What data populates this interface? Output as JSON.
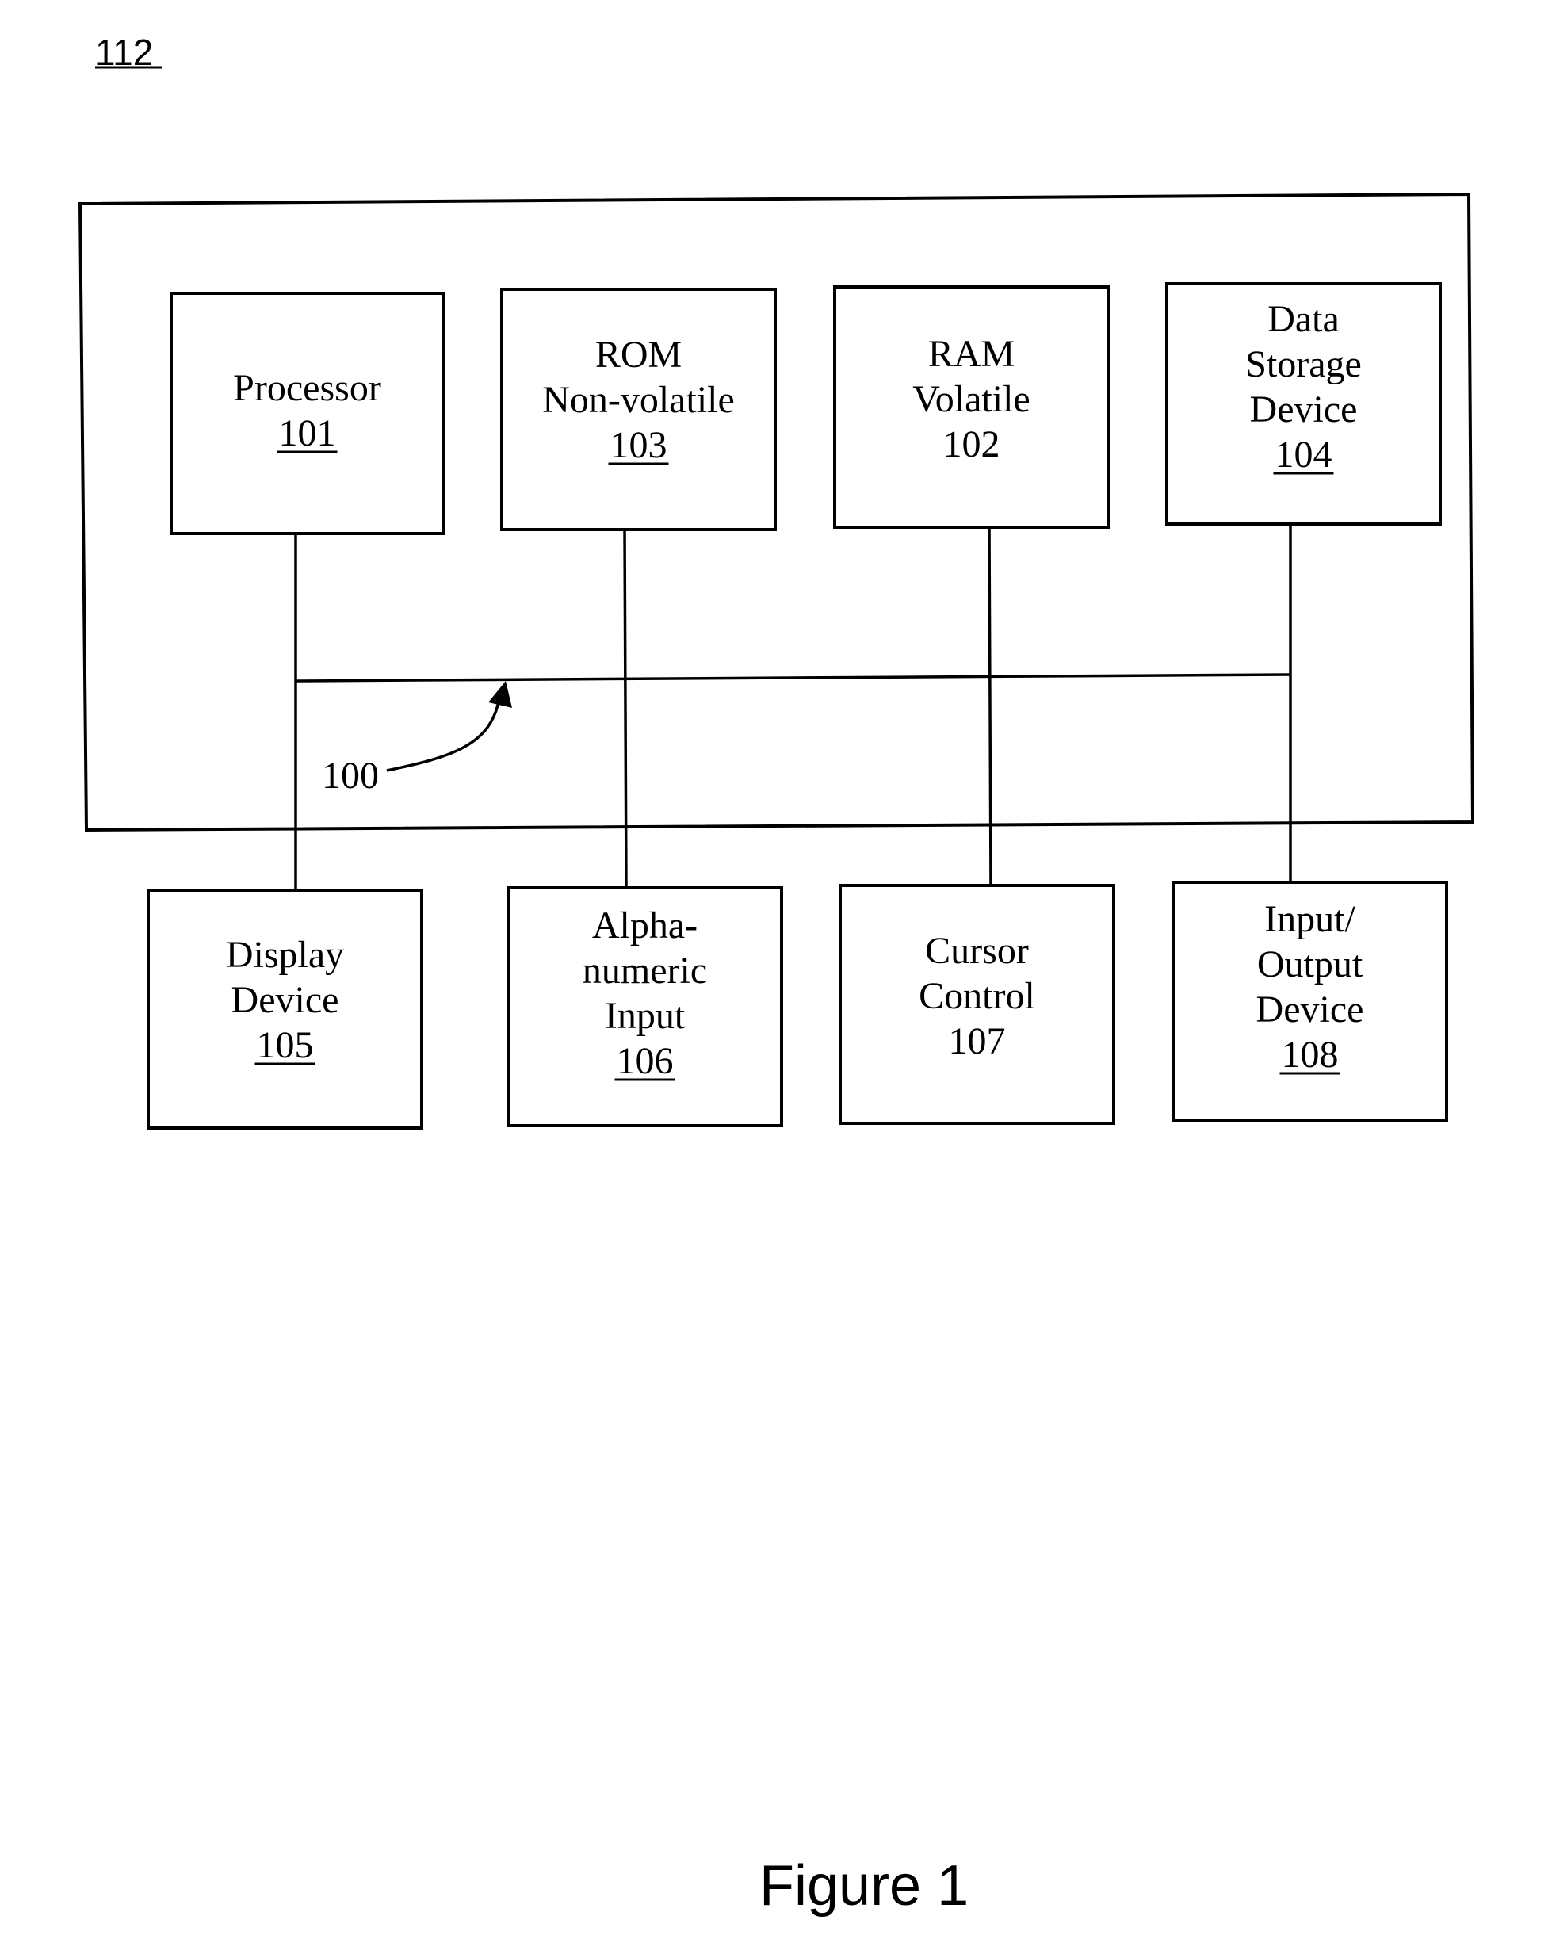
{
  "figure_ref": "112",
  "caption": "Figure 1",
  "bus": {
    "ref": "100"
  },
  "internal_components": [
    {
      "id": "processor",
      "lines": [
        "Processor"
      ],
      "ref": "101",
      "ref_underlined": true
    },
    {
      "id": "rom",
      "lines": [
        "ROM",
        "Non-volatile"
      ],
      "ref": "103",
      "ref_underlined": true
    },
    {
      "id": "ram",
      "lines": [
        "RAM",
        "Volatile"
      ],
      "ref": "102",
      "ref_underlined": false
    },
    {
      "id": "data-storage",
      "lines": [
        "Data",
        "Storage",
        "Device"
      ],
      "ref": "104",
      "ref_underlined": true
    }
  ],
  "external_components": [
    {
      "id": "display-device",
      "lines": [
        "Display",
        "Device"
      ],
      "ref": "105",
      "ref_underlined": true
    },
    {
      "id": "alphanumeric-input",
      "lines": [
        "Alpha-",
        "numeric",
        "Input"
      ],
      "ref": "106",
      "ref_underlined": true
    },
    {
      "id": "cursor-control",
      "lines": [
        "Cursor",
        "Control"
      ],
      "ref": "107",
      "ref_underlined": false
    },
    {
      "id": "io-device",
      "lines": [
        "Input/",
        "Output",
        "Device"
      ],
      "ref": "108",
      "ref_underlined": true
    }
  ],
  "colors": {
    "ink": "#000000",
    "paper": "#ffffff"
  }
}
